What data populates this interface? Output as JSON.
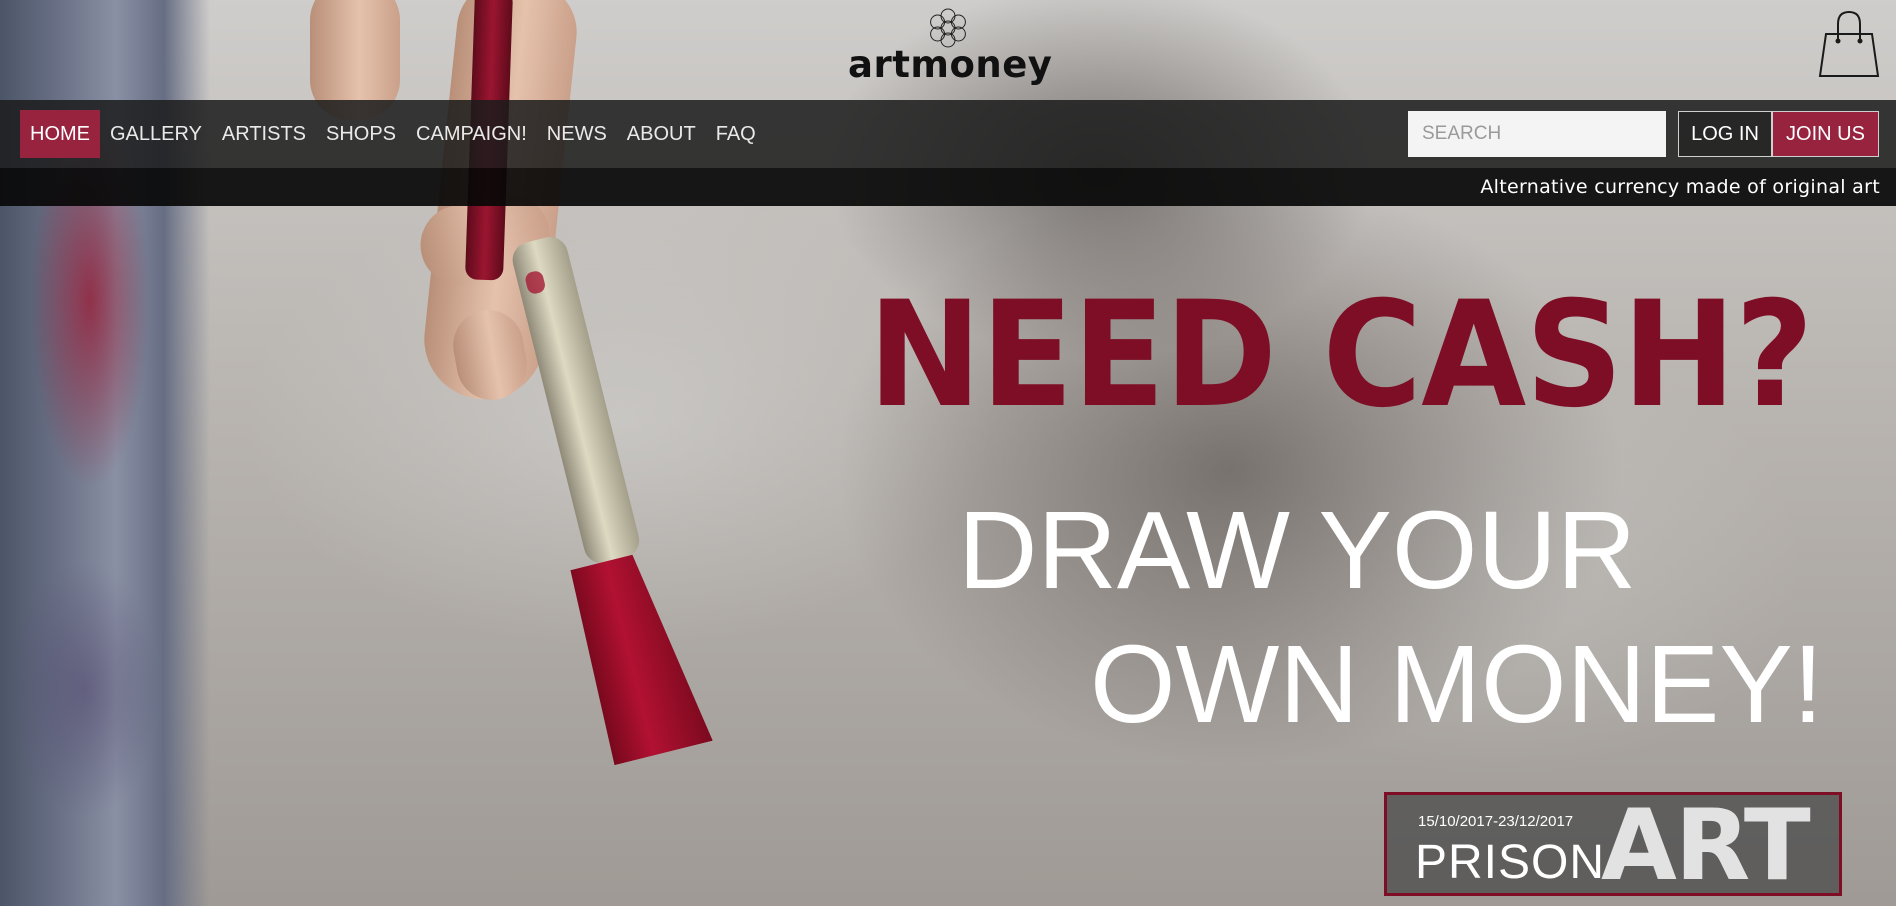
{
  "brand": {
    "name": "artmoney",
    "logo_icon": "flower-of-life-icon"
  },
  "cart": {
    "icon": "shopping-bag-icon"
  },
  "nav": {
    "items": [
      {
        "label": "HOME",
        "active": true
      },
      {
        "label": "GALLERY",
        "active": false
      },
      {
        "label": "ARTISTS",
        "active": false
      },
      {
        "label": "SHOPS",
        "active": false
      },
      {
        "label": "CAMPAIGN!",
        "active": false
      },
      {
        "label": "NEWS",
        "active": false
      },
      {
        "label": "ABOUT",
        "active": false
      },
      {
        "label": "FAQ",
        "active": false
      }
    ]
  },
  "search": {
    "placeholder": "SEARCH",
    "value": ""
  },
  "auth": {
    "login_label": "LOG IN",
    "join_label": "JOIN US"
  },
  "tagline": "Alternative currency made of original art",
  "hero": {
    "headline": "NEED CASH?",
    "subline_1": "DRAW YOUR",
    "subline_2": "OWN MONEY!"
  },
  "banner": {
    "dates": "15/10/2017-23/12/2017",
    "title_light": "PRISON",
    "title_bold": "ART"
  },
  "colors": {
    "accent": "#97233f",
    "headline": "#7e0d26",
    "nav_bg": "#1c1c1c",
    "tagline_bg": "#080808"
  }
}
